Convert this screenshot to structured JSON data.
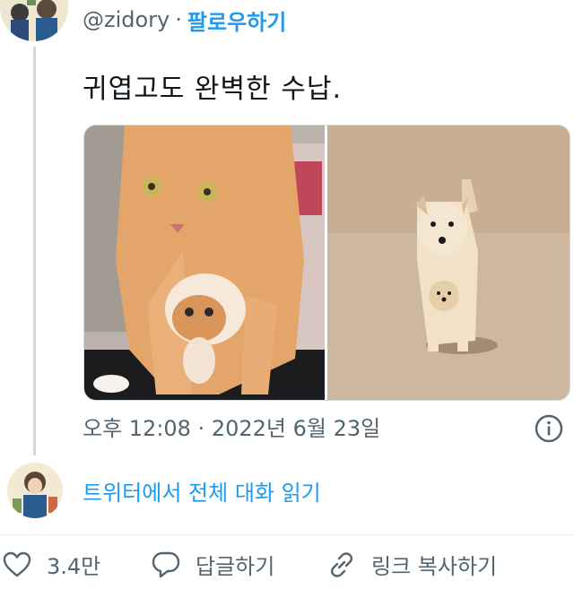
{
  "tweet": {
    "handle": "@zidory",
    "separator": "·",
    "follow_label": "팔로우하기",
    "text": "귀엽고도 완벽한 수납.",
    "timestamp": "오후 12:08 · 2022년 6월 23일"
  },
  "thread": {
    "read_label": "트위터에서 전체 대화 읽기"
  },
  "actions": {
    "like_count": "3.4만",
    "reply_label": "답글하기",
    "copy_link_label": "링크 복사하기"
  },
  "colors": {
    "accent": "#1d9bf0",
    "secondary_text": "#536471",
    "primary_text": "#0f1419"
  },
  "icons": {
    "like": "heart-icon",
    "reply": "speech-bubble-icon",
    "copy_link": "link-icon",
    "info": "info-icon"
  }
}
